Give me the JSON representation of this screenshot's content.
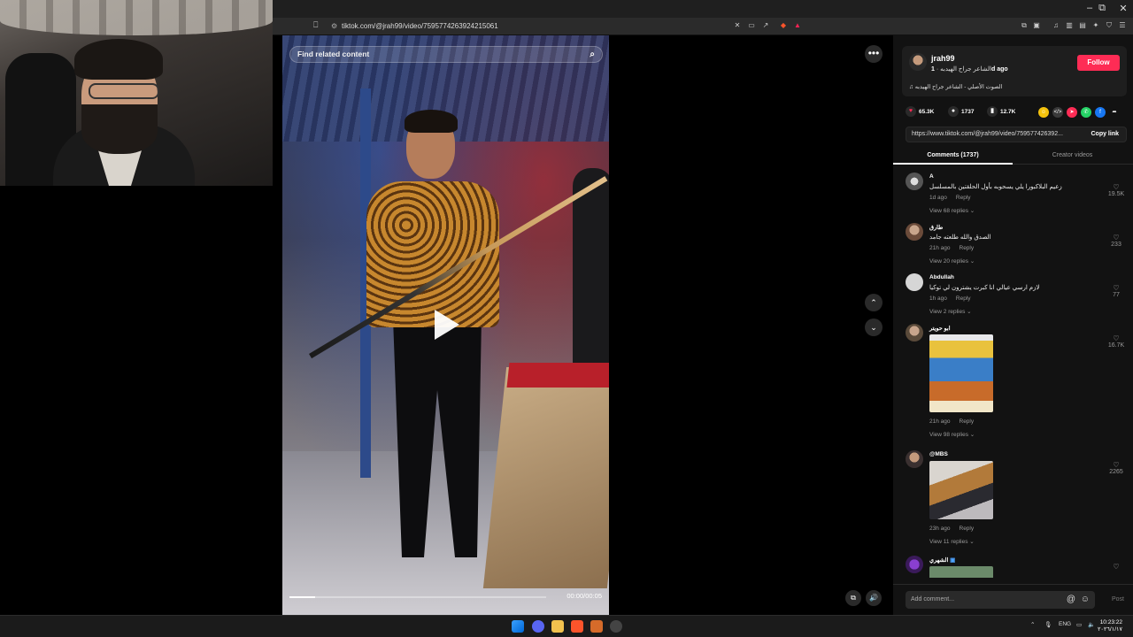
{
  "browser": {
    "url": "tiktok.com/@jrah99/video/7595774263924215061",
    "window_controls": [
      "–",
      "⧉",
      "✕"
    ]
  },
  "video": {
    "search_placeholder": "Find related content",
    "timecode": "00:00/00:05",
    "progress": 0.1
  },
  "creator": {
    "username": "jrah99",
    "display_name": "الشاعر جراح الهيدبه",
    "posted": "1d ago",
    "follow_label": "Follow",
    "sound": "الصوت الأصلي - الشاعر جراح الهيدبه"
  },
  "stats": {
    "likes": "65.3K",
    "comments": "1737",
    "saves": "12.7K"
  },
  "share": {
    "link": "https://www.tiktok.com/@jrah99/video/759577426392...",
    "copy_label": "Copy link",
    "colors": [
      "#f4c20d",
      "#3a3a3a",
      "#fe2c55",
      "#25d366",
      "#1877f2"
    ]
  },
  "tabs": [
    "Comments (1737)",
    "Creator videos"
  ],
  "comments": [
    {
      "name": "A",
      "text": "زعيم البلاكبورا يلي يسحوبه بأول الحلقتين بالمسلسل",
      "time": "1d ago",
      "reply": "Reply",
      "replies": "View 68 replies",
      "likes": "19.5K"
    },
    {
      "name": "طارق",
      "text": "الصدق والله طلعته جامد",
      "time": "21h ago",
      "reply": "Reply",
      "replies": "View 20 replies",
      "likes": "233"
    },
    {
      "name": "Abdullah",
      "text": "لازم ارسي عيالي انا كبرت يشترون لي توكيا",
      "time": "1h ago",
      "reply": "Reply",
      "replies": "View 2 replies",
      "likes": "77"
    },
    {
      "name": "ابو حويتر",
      "text": "",
      "time": "21h ago",
      "reply": "Reply",
      "replies": "View 98 replies",
      "likes": "16.7K"
    },
    {
      "name": "@MBS",
      "text": "",
      "time": "23h ago",
      "reply": "Reply",
      "replies": "View 11 replies",
      "likes": "2265"
    },
    {
      "name": "الشهري",
      "text": "",
      "time": "",
      "reply": "",
      "replies": "",
      "likes": ""
    }
  ],
  "add_comment": {
    "placeholder": "Add comment...",
    "post_label": "Post"
  },
  "taskbar": {
    "lang": "ENG",
    "time": "10:23:22",
    "date": "٢٠٢٦/١/١٧"
  }
}
